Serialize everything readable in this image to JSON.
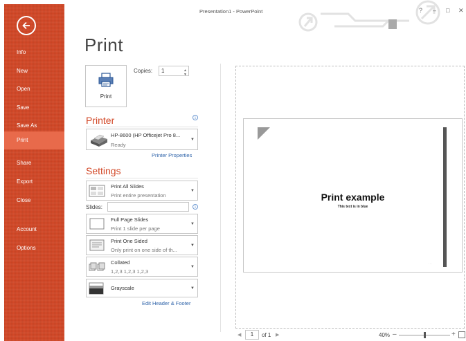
{
  "window": {
    "title": "Presentation1 - PowerPoint",
    "help": "?",
    "minimize": "–",
    "maximize": "□",
    "close": "✕"
  },
  "sidebar": {
    "items": [
      {
        "label": "Info"
      },
      {
        "label": "New"
      },
      {
        "label": "Open"
      },
      {
        "label": "Save"
      },
      {
        "label": "Save As"
      },
      {
        "label": "Print"
      },
      {
        "label": "Share"
      },
      {
        "label": "Export"
      },
      {
        "label": "Close"
      },
      {
        "label": "Account"
      },
      {
        "label": "Options"
      }
    ],
    "active": "Print",
    "accent_color": "#d24726"
  },
  "page": {
    "title": "Print"
  },
  "print_button": {
    "label": "Print"
  },
  "copies": {
    "label": "Copies:",
    "value": "1"
  },
  "printer": {
    "section_title": "Printer",
    "name": "HP-8600 (HP Officejet Pro 8...",
    "status": "Ready",
    "properties_link": "Printer Properties"
  },
  "settings": {
    "section_title": "Settings",
    "slides_range": {
      "title": "Print All Slides",
      "subtitle": "Print entire presentation"
    },
    "slides_label": "Slides:",
    "slides_value": "",
    "layout": {
      "title": "Full Page Slides",
      "subtitle": "Print 1 slide per page"
    },
    "sides": {
      "title": "Print One Sided",
      "subtitle": "Only print on one side of th..."
    },
    "collation": {
      "title": "Collated",
      "subtitle": "1,2,3    1,2,3    1,2,3"
    },
    "color": {
      "title": "Grayscale"
    },
    "header_footer_link": "Edit Header & Footer"
  },
  "preview": {
    "slide_title": "Print example",
    "slide_subtitle": "This text is in blue",
    "page_value": "1",
    "page_of": "of 1",
    "zoom": "40%",
    "zoom_fraction": 0.4
  }
}
